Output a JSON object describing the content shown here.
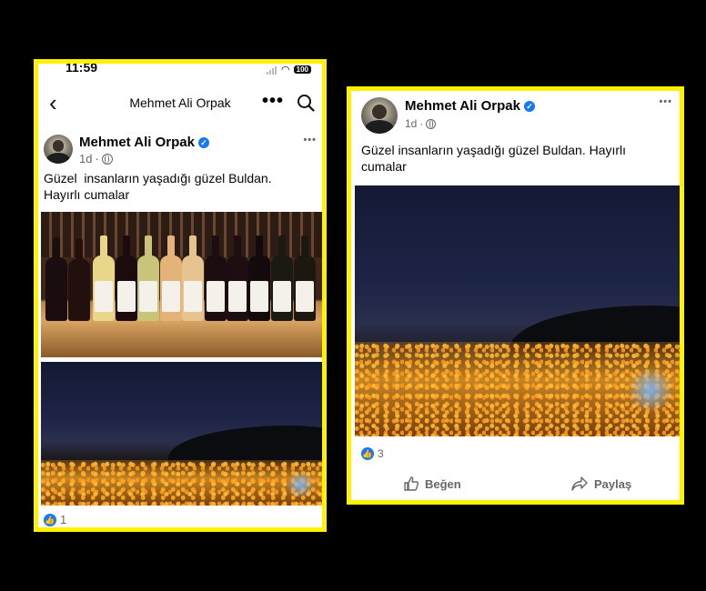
{
  "left_post": {
    "status_time": "11:59",
    "battery": "100",
    "nav_title": "Mehmet Ali Orpak",
    "nav_more": "•••",
    "author": "Mehmet Ali Orpak",
    "verified_mark": "✓",
    "timestamp": "1d",
    "separator": "·",
    "more": "•••",
    "text": "Güzel  insanların yaşadığı güzel Buldan.\nHayırlı cumalar",
    "reaction_icon": "like-icon",
    "reaction_count": "1"
  },
  "right_post": {
    "author": "Mehmet Ali Orpak",
    "verified_mark": "✓",
    "timestamp": "1d",
    "separator": "·",
    "more": "•••",
    "text": "Güzel insanların yaşadığı güzel Buldan. Hayırlı\ncumalar",
    "reaction_icon": "like-icon",
    "reaction_count": "3",
    "like_label": "Beğen",
    "share_label": "Paylaş"
  },
  "colors": {
    "frame": "#fff200",
    "verified": "#1877f2",
    "meta_text": "#65676b"
  }
}
